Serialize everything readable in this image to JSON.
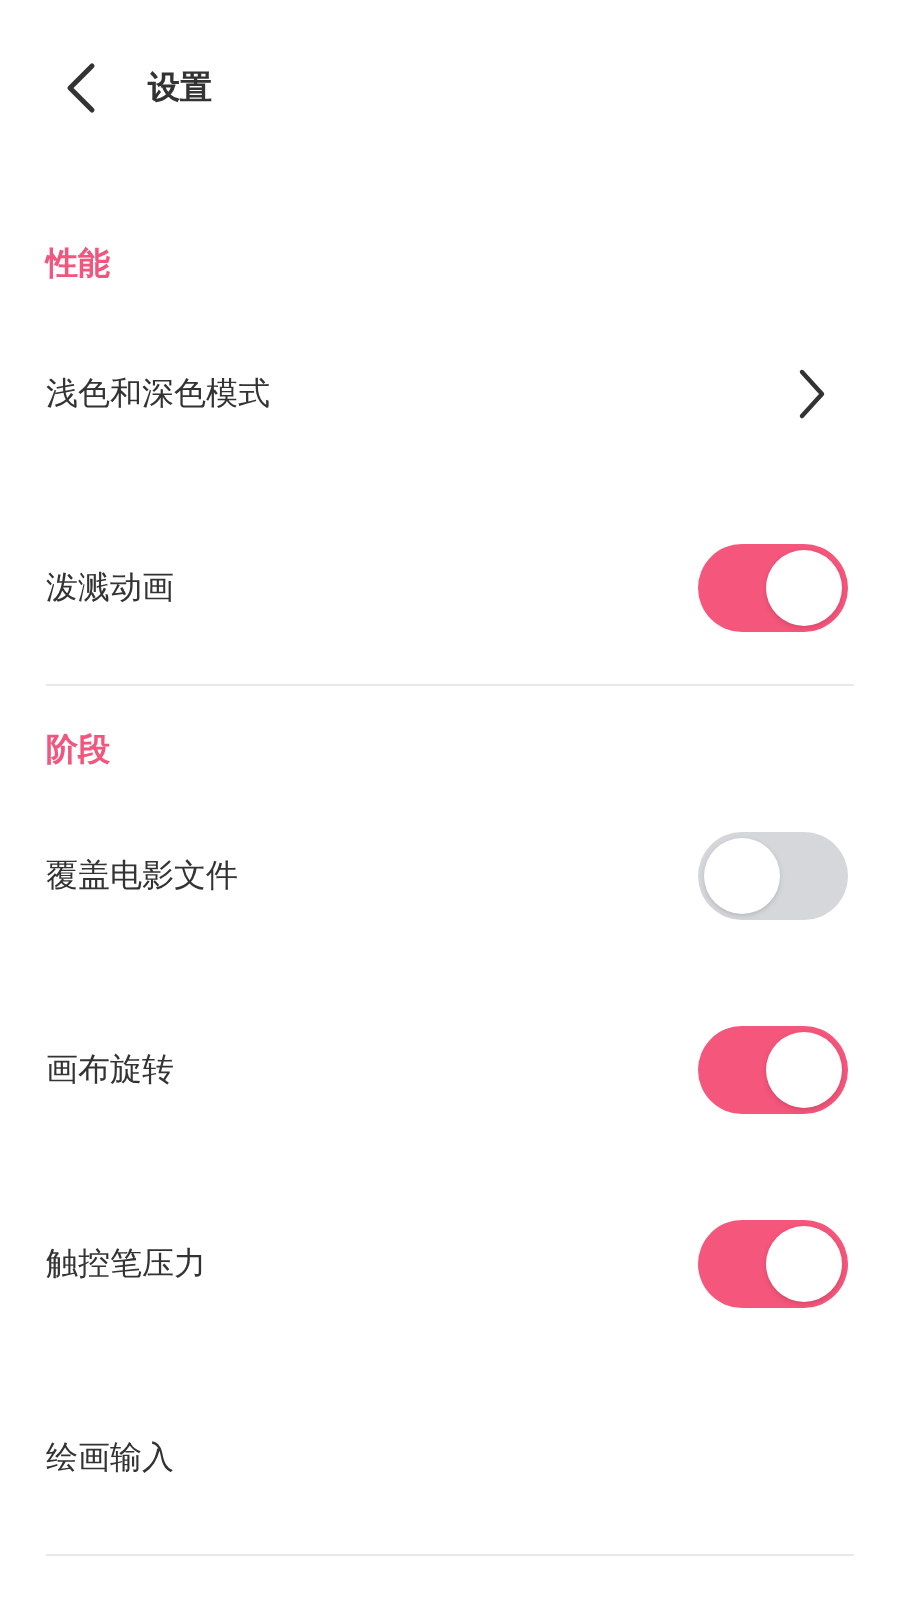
{
  "header": {
    "title": "设置"
  },
  "sections": [
    {
      "title": "性能",
      "items": [
        {
          "kind": "link",
          "label": "浅色和深色模式"
        },
        {
          "kind": "toggle",
          "label": "泼溅动画",
          "on": true
        }
      ]
    },
    {
      "title": "阶段",
      "items": [
        {
          "kind": "toggle",
          "label": "覆盖电影文件",
          "on": false
        },
        {
          "kind": "toggle",
          "label": "画布旋转",
          "on": true
        },
        {
          "kind": "toggle",
          "label": "触控笔压力",
          "on": true
        },
        {
          "kind": "plain",
          "label": "绘画输入"
        }
      ]
    }
  ]
}
